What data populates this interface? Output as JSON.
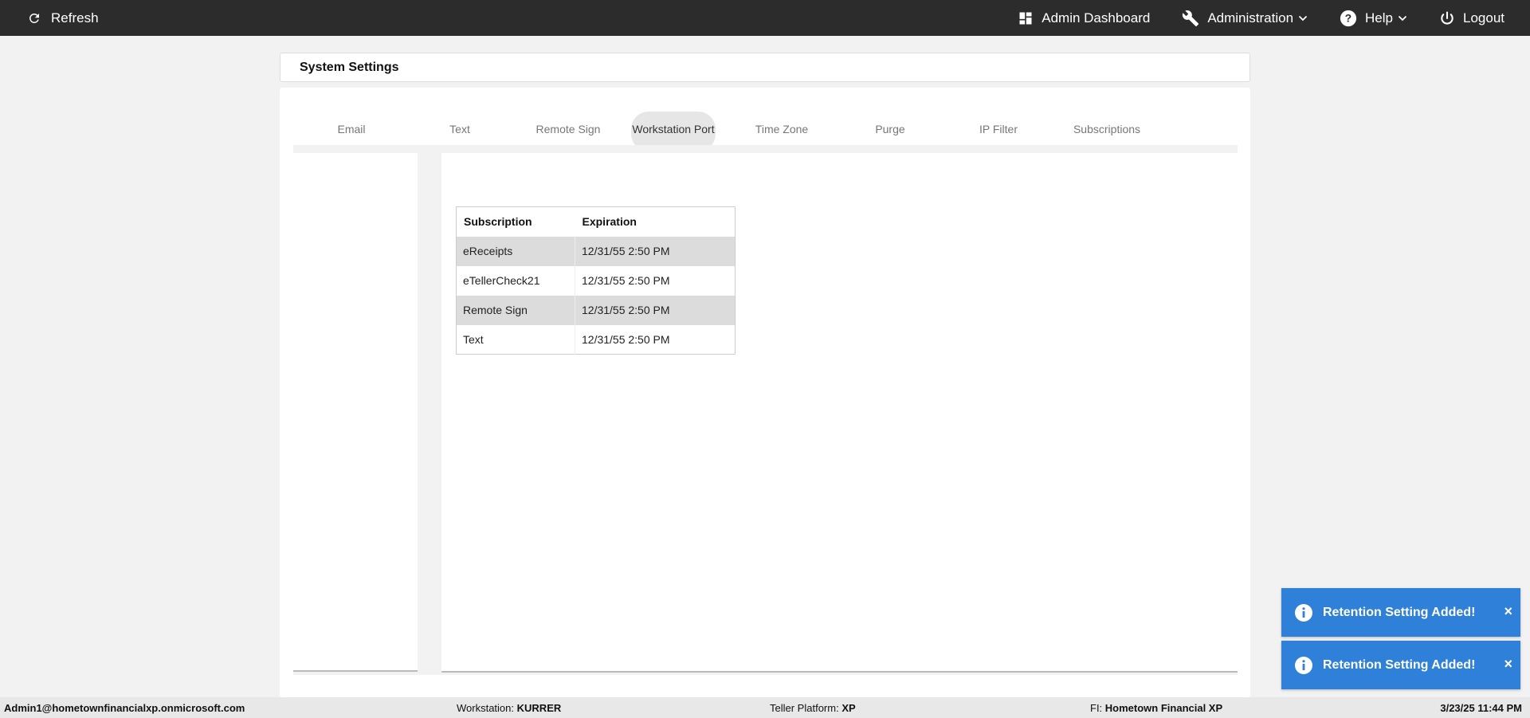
{
  "topbar": {
    "refresh_label": "Refresh",
    "admin_dashboard_label": "Admin Dashboard",
    "administration_label": "Administration",
    "help_label": "Help",
    "logout_label": "Logout"
  },
  "header": {
    "title": "System Settings"
  },
  "tabs": [
    {
      "label": "Email"
    },
    {
      "label": "Text"
    },
    {
      "label": "Remote Sign"
    },
    {
      "label": "Workstation Port"
    },
    {
      "label": "Time Zone"
    },
    {
      "label": "Purge"
    },
    {
      "label": "IP Filter"
    },
    {
      "label": "Subscriptions"
    }
  ],
  "table": {
    "headers": [
      "Subscription",
      "Expiration"
    ],
    "rows": [
      [
        "eReceipts",
        "12/31/55 2:50 PM"
      ],
      [
        "eTellerCheck21",
        "12/31/55 2:50 PM"
      ],
      [
        "Remote Sign",
        "12/31/55 2:50 PM"
      ],
      [
        "Text",
        "12/31/55 2:50 PM"
      ]
    ]
  },
  "toasts": [
    {
      "message": "Retention Setting Added!",
      "close": "×"
    },
    {
      "message": "Retention Setting Added!",
      "close": "×"
    }
  ],
  "status": {
    "user": "Admin1@hometownfinancialxp.onmicrosoft.com",
    "workstation_label": "Workstation:",
    "workstation_value": "KURRER",
    "platform_label": "Teller Platform:",
    "platform_value": "XP",
    "fi_label": "FI:",
    "fi_value": "Hometown Financial XP",
    "datetime": "3/23/25 11:44 PM"
  },
  "colors": {
    "topbar_bg": "#2c2c2c",
    "toast_bg": "#2f80d8",
    "tab_indicator": "#3f51b5"
  },
  "icons": {
    "refresh": "refresh-icon",
    "dashboard": "dashboard-icon",
    "administration": "wrench-icon",
    "help": "help-circle-icon",
    "logout": "power-icon",
    "toast": "info-circle-icon"
  }
}
